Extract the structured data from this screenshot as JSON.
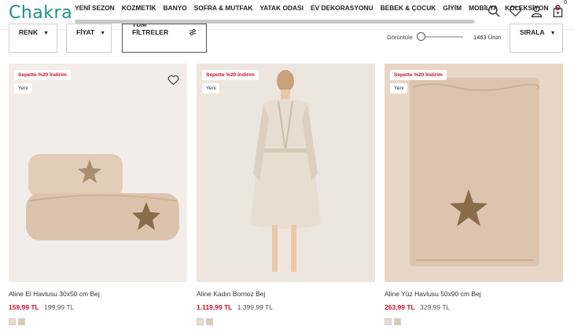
{
  "brand": {
    "logo_text": "Chakra",
    "color": "#1f8f86"
  },
  "nav": {
    "items": [
      "YENİ SEZON",
      "KOZMETİK",
      "BANYO",
      "SOFRA & MUTFAK",
      "YATAK ODASI",
      "EV DEKORASYONU",
      "BEBEK & ÇOCUK",
      "GİYİM",
      "MOBİLYA",
      "KOLEKSİYON"
    ],
    "cut_item": "S"
  },
  "header_icons": [
    "search-icon",
    "heart-icon",
    "user-icon",
    "cart-icon"
  ],
  "cart_count": "0",
  "filters": {
    "color": "RENK",
    "price": "FİYAT",
    "all_filters": "TÜM FİLTRELER",
    "sort": "SIRALA",
    "view_label": "Görüntüle",
    "product_count": "1463 Ürün"
  },
  "accent_red": "#c8102e",
  "products": [
    {
      "name": "Aline El Havlusu 30x50 cm Bej",
      "discount_badge": "Sepette %20 İndirim",
      "new_badge": "Yeni",
      "price_now": "159,99 TL",
      "price_old": "199,99 TL"
    },
    {
      "name": "Aline Kadın Bornoz Bej",
      "discount_badge": "Sepette %20 İndirim",
      "new_badge": "Yeni",
      "price_now": "1.119,99 TL",
      "price_old": "1.399,99 TL"
    },
    {
      "name": "Aline Yüz Havlusu 50x90 cm Bej",
      "discount_badge": "Sepette %20 İndirim",
      "new_badge": "Yeni",
      "price_now": "263,99 TL",
      "price_old": "329,99 TL"
    }
  ]
}
